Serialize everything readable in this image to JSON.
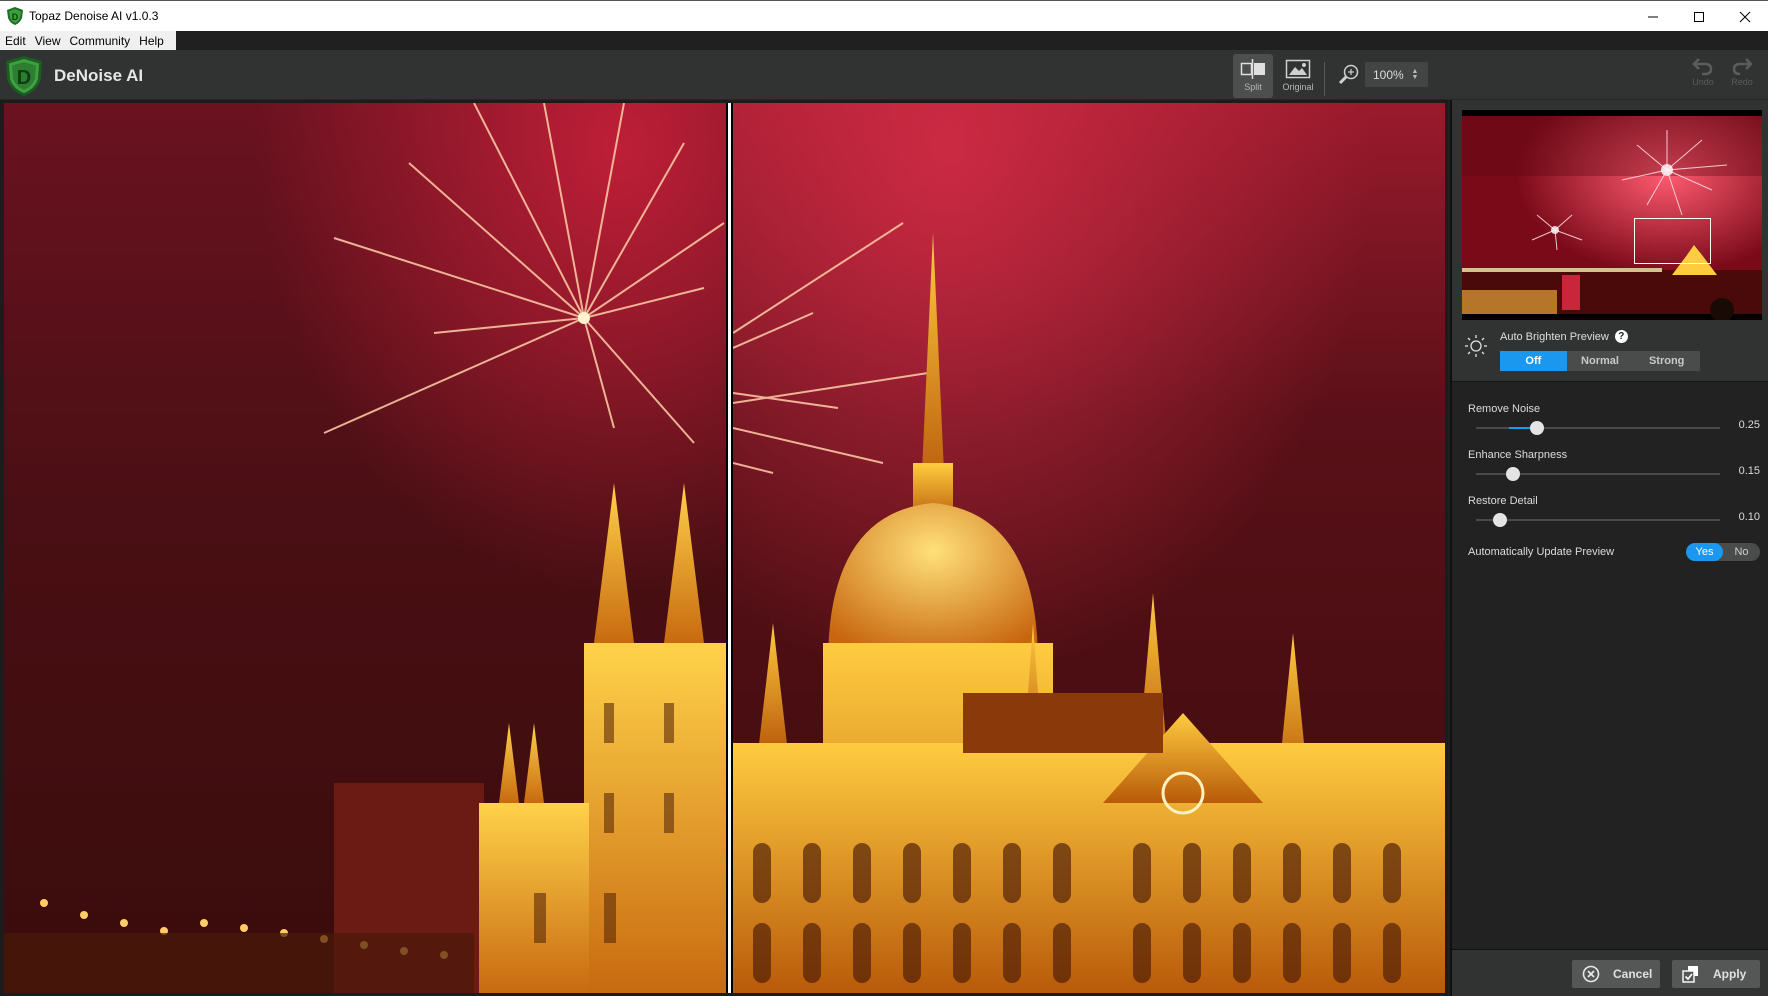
{
  "window": {
    "title": "Topaz Denoise AI v1.0.3",
    "controls": {
      "minimize": "—",
      "maximize": "☐",
      "close": "✕"
    }
  },
  "menu": {
    "items": [
      {
        "label": "Edit"
      },
      {
        "label": "View"
      },
      {
        "label": "Community"
      },
      {
        "label": "Help"
      }
    ]
  },
  "toolbar": {
    "brand_letter": "D",
    "brand_name": "DeNoise AI",
    "split_label": "Split",
    "original_label": "Original",
    "view_mode": "Split",
    "zoom_value": "100%",
    "undo_label": "Undo",
    "redo_label": "Redo"
  },
  "viewer": {
    "mode": "split",
    "left_pane": "original",
    "right_pane": "preview"
  },
  "panel": {
    "navigator": {
      "description": "Thumbnail of fireworks over Budapest Parliament at night",
      "viewport_box": "Parliament building region"
    },
    "auto_brighten": {
      "label": "Auto Brighten Preview",
      "help": "?",
      "options": [
        {
          "label": "Off",
          "active": true
        },
        {
          "label": "Normal",
          "active": false
        },
        {
          "label": "Strong",
          "active": false
        }
      ]
    },
    "sliders": [
      {
        "label": "Remove Noise",
        "value": 0.25,
        "display": "0.25"
      },
      {
        "label": "Enhance Sharpness",
        "value": 0.15,
        "display": "0.15"
      },
      {
        "label": "Restore Detail",
        "value": 0.1,
        "display": "0.10"
      }
    ],
    "auto_update": {
      "label": "Automatically Update Preview",
      "yes": "Yes",
      "no": "No",
      "selected": "Yes"
    },
    "footer": {
      "cancel_label": "Cancel",
      "apply_label": "Apply"
    }
  },
  "colors": {
    "accent": "#1a98f0",
    "panel_bg": "#222222",
    "toolbar_bg": "#313232",
    "brand_green": "#2e8b2e"
  }
}
